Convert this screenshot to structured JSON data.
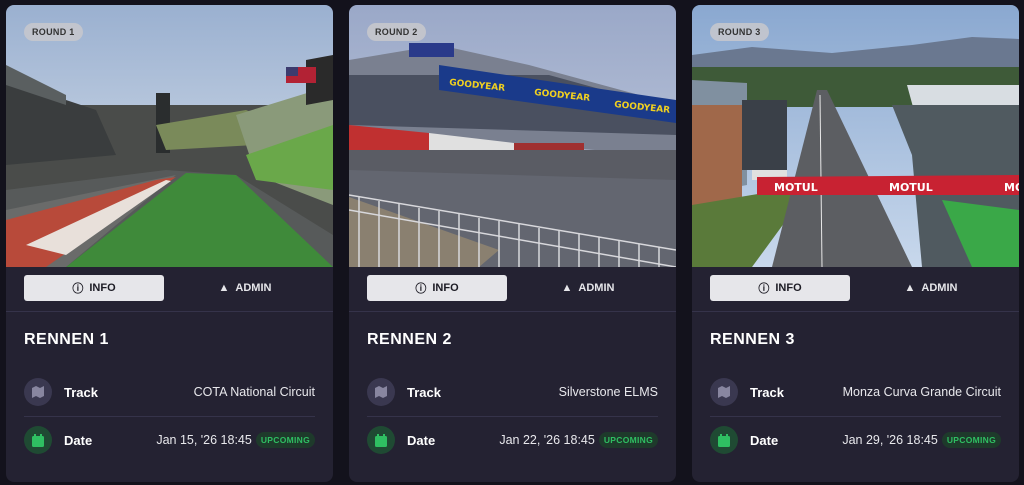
{
  "colors": {
    "background": "#13121c",
    "card": "#242232",
    "upcoming": "#2fbf62"
  },
  "tabs": {
    "info_label": "INFO",
    "admin_label": "ADMIN",
    "info_icon": "info-circle-icon",
    "admin_icon": "warning-triangle-icon"
  },
  "labels": {
    "track": "Track",
    "date": "Date",
    "upcoming": "UPCOMING",
    "track_icon": "map-icon",
    "date_icon": "calendar-icon"
  },
  "cards": [
    {
      "round": "ROUND 1",
      "title": "RENNEN 1",
      "track": "COTA National Circuit",
      "date": "Jan 15, '26 18:45",
      "status": "UPCOMING"
    },
    {
      "round": "ROUND 2",
      "title": "RENNEN 2",
      "track": "Silverstone ELMS",
      "date": "Jan 22, '26 18:45",
      "status": "UPCOMING"
    },
    {
      "round": "ROUND 3",
      "title": "RENNEN 3",
      "track": "Monza Curva Grande Circuit",
      "date": "Jan 29, '26 18:45",
      "status": "UPCOMING"
    }
  ],
  "hero_text": {
    "goodyear": "GOODYEAR",
    "motul": "MOTUL"
  }
}
